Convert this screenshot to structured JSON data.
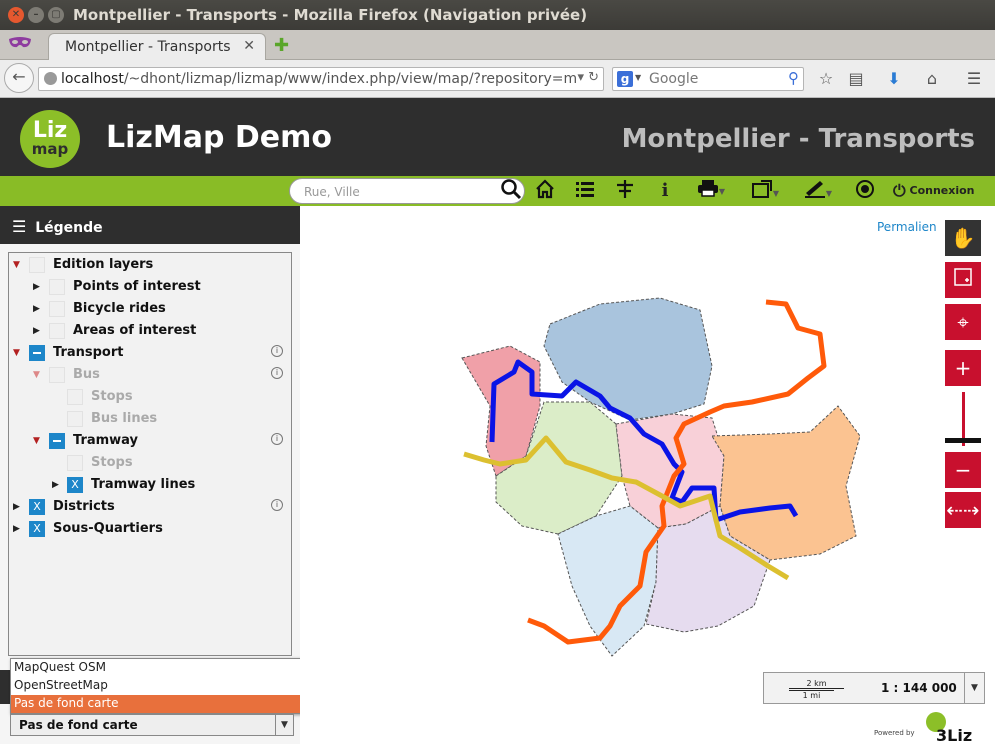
{
  "window": {
    "title": "Montpellier - Transports - Mozilla Firefox (Navigation privée)"
  },
  "browser": {
    "tab_title": "Montpellier - Transports",
    "url_host": "localhost",
    "url_path": "/~dhont/lizmap/lizmap/www/index.php/view/map/?repository=m",
    "search_placeholder": "Google"
  },
  "header": {
    "logo_top": "Liz",
    "logo_bottom": "map",
    "app_title": "LizMap Demo",
    "project_title": "Montpellier - Transports"
  },
  "toolbar": {
    "search_placeholder": "Rue, Ville",
    "connexion_label": "Connexion"
  },
  "legend": {
    "title": "Légende",
    "items": [
      {
        "label": "Edition layers"
      },
      {
        "label": "Points of interest"
      },
      {
        "label": "Bicycle rides"
      },
      {
        "label": "Areas of interest"
      },
      {
        "label": "Transport"
      },
      {
        "label": "Bus"
      },
      {
        "label": "Stops"
      },
      {
        "label": "Bus lines"
      },
      {
        "label": "Tramway"
      },
      {
        "label": "Stops"
      },
      {
        "label": "Tramway lines"
      },
      {
        "label": "Districts"
      },
      {
        "label": "Sous-Quartiers"
      }
    ]
  },
  "baselayer": {
    "options": [
      "MapQuest OSM",
      "OpenStreetMap",
      "Pas de fond carte"
    ],
    "selected": "Pas de fond carte"
  },
  "map": {
    "permalink_label": "Permalien",
    "scale_km": "2 km",
    "scale_mi": "1 mi",
    "scale_text": "1 : 144 000",
    "powered_by": "Powered by",
    "powered_logo": "3Liz"
  },
  "colors": {
    "header_dark": "#2e2e2e",
    "toolbar_green": "#89bc26",
    "accent_red": "#c8102e",
    "checkbox_blue": "#1d86c9",
    "selected_option": "#e8703c",
    "tram_blue": "#0a14e6",
    "tram_orange": "#ff5a0a",
    "tram_yellow": "#dcc030"
  }
}
